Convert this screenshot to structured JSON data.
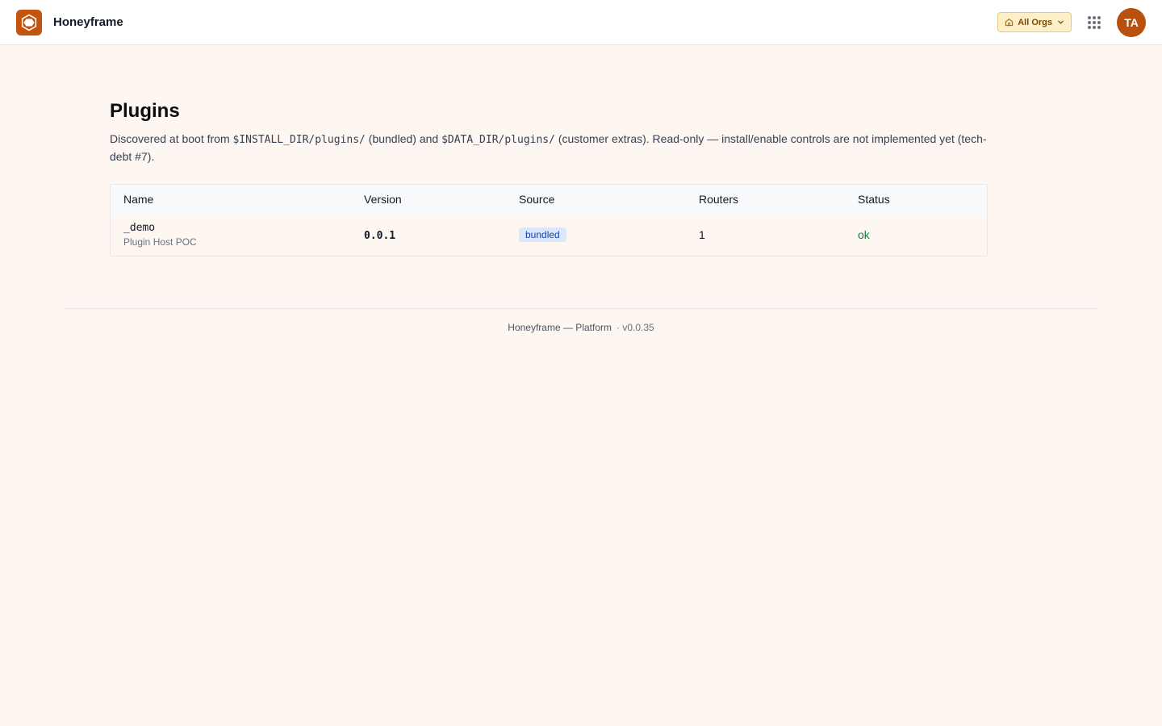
{
  "header": {
    "brand": "Honeyframe",
    "org_selector": "All Orgs",
    "avatar_initials": "TA"
  },
  "page": {
    "title": "Plugins",
    "description": {
      "part1": "Discovered at boot from ",
      "code1": "$INSTALL_DIR/plugins/",
      "part2": " (bundled) and ",
      "code2": "$DATA_DIR/plugins/",
      "part3": " (customer extras). Read-only — install/enable controls are not implemented yet (tech-debt #7)."
    }
  },
  "table": {
    "columns": [
      "Name",
      "Version",
      "Source",
      "Routers",
      "Status"
    ],
    "rows": [
      {
        "name": "_demo",
        "subtitle": "Plugin Host POC",
        "version": "0.0.1",
        "source": "bundled",
        "routers": "1",
        "status": "ok"
      }
    ]
  },
  "footer": {
    "text": "Honeyframe — Platform",
    "version": "· v0.0.35"
  },
  "colors": {
    "brand": "#c2540f",
    "background": "#fdf6f1",
    "status_ok": "#15803d",
    "badge_bg": "#dbe7fb"
  },
  "icons": {
    "logo": "hexagon-logo-icon",
    "org": "home-icon",
    "org_dropdown": "chevron-down-icon",
    "apps": "apps-grid-icon"
  }
}
